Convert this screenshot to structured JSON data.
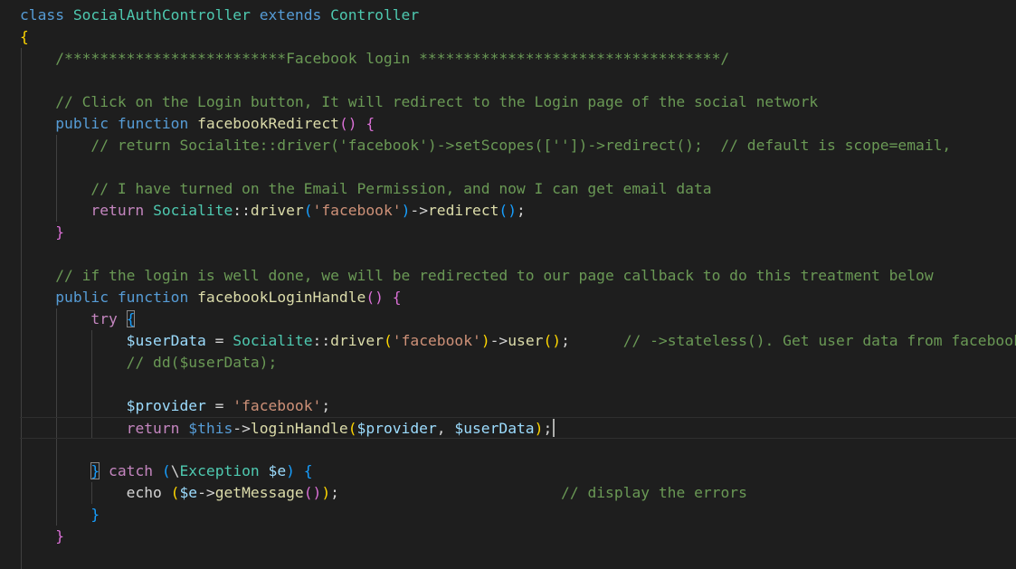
{
  "editor": {
    "language": "php",
    "theme": "dark",
    "current_line": 19,
    "colors": {
      "background": "#1e1e1e",
      "keyword": "#569cd6",
      "class": "#4ec9b0",
      "function": "#dcdcaa",
      "variable": "#9cdcfe",
      "string": "#ce9178",
      "comment": "#6a9955",
      "control": "#c586c0",
      "text": "#d4d4d4",
      "bracket1": "#ffd700",
      "bracket2": "#da70d6",
      "bracket3": "#179fff"
    },
    "lines": [
      [
        {
          "t": "class",
          "c": "kw"
        },
        {
          "t": " ",
          "c": "txt"
        },
        {
          "t": "SocialAuthController",
          "c": "cls"
        },
        {
          "t": " ",
          "c": "txt"
        },
        {
          "t": "extends",
          "c": "kw"
        },
        {
          "t": " ",
          "c": "txt"
        },
        {
          "t": "Controller",
          "c": "cls"
        }
      ],
      [
        {
          "t": "{",
          "c": "b1"
        }
      ],
      [
        {
          "t": "    ",
          "c": "txt"
        },
        {
          "t": "/*************************Facebook login **********************************/",
          "c": "com"
        }
      ],
      [],
      [
        {
          "t": "    ",
          "c": "txt"
        },
        {
          "t": "// Click on the Login button, It will redirect to the Login page of the social network",
          "c": "com"
        }
      ],
      [
        {
          "t": "    ",
          "c": "txt"
        },
        {
          "t": "public",
          "c": "kw"
        },
        {
          "t": " ",
          "c": "txt"
        },
        {
          "t": "function",
          "c": "kw"
        },
        {
          "t": " ",
          "c": "txt"
        },
        {
          "t": "facebookRedirect",
          "c": "fn"
        },
        {
          "t": "()",
          "c": "b2"
        },
        {
          "t": " ",
          "c": "txt"
        },
        {
          "t": "{",
          "c": "b2"
        }
      ],
      [
        {
          "t": "        ",
          "c": "txt"
        },
        {
          "t": "// return Socialite::driver('facebook')->setScopes([''])->redirect();  // default is scope=email,",
          "c": "com"
        }
      ],
      [],
      [
        {
          "t": "        ",
          "c": "txt"
        },
        {
          "t": "// I have turned on the Email Permission, and now I can get email data",
          "c": "com"
        }
      ],
      [
        {
          "t": "        ",
          "c": "txt"
        },
        {
          "t": "return",
          "c": "ctl"
        },
        {
          "t": " ",
          "c": "txt"
        },
        {
          "t": "Socialite",
          "c": "cls"
        },
        {
          "t": "::",
          "c": "txt"
        },
        {
          "t": "driver",
          "c": "fn"
        },
        {
          "t": "(",
          "c": "b3"
        },
        {
          "t": "'facebook'",
          "c": "str"
        },
        {
          "t": ")",
          "c": "b3"
        },
        {
          "t": "->",
          "c": "txt"
        },
        {
          "t": "redirect",
          "c": "fn"
        },
        {
          "t": "()",
          "c": "b3"
        },
        {
          "t": ";",
          "c": "txt"
        }
      ],
      [
        {
          "t": "    ",
          "c": "txt"
        },
        {
          "t": "}",
          "c": "b2"
        }
      ],
      [],
      [
        {
          "t": "    ",
          "c": "txt"
        },
        {
          "t": "// if the login is well done, we will be redirected to our page callback to do this treatment below",
          "c": "com"
        }
      ],
      [
        {
          "t": "    ",
          "c": "txt"
        },
        {
          "t": "public",
          "c": "kw"
        },
        {
          "t": " ",
          "c": "txt"
        },
        {
          "t": "function",
          "c": "kw"
        },
        {
          "t": " ",
          "c": "txt"
        },
        {
          "t": "facebookLoginHandle",
          "c": "fn"
        },
        {
          "t": "()",
          "c": "b2"
        },
        {
          "t": " ",
          "c": "txt"
        },
        {
          "t": "{",
          "c": "b2"
        }
      ],
      [
        {
          "t": "        ",
          "c": "txt"
        },
        {
          "t": "try",
          "c": "ctl"
        },
        {
          "t": " ",
          "c": "txt"
        },
        {
          "t": "{",
          "c": "b3",
          "boxed": true
        }
      ],
      [
        {
          "t": "            ",
          "c": "txt"
        },
        {
          "t": "$userData",
          "c": "var"
        },
        {
          "t": " = ",
          "c": "txt"
        },
        {
          "t": "Socialite",
          "c": "cls"
        },
        {
          "t": "::",
          "c": "txt"
        },
        {
          "t": "driver",
          "c": "fn"
        },
        {
          "t": "(",
          "c": "b1"
        },
        {
          "t": "'facebook'",
          "c": "str"
        },
        {
          "t": ")",
          "c": "b1"
        },
        {
          "t": "->",
          "c": "txt"
        },
        {
          "t": "user",
          "c": "fn"
        },
        {
          "t": "()",
          "c": "b1"
        },
        {
          "t": ";",
          "c": "txt"
        },
        {
          "t": "      ",
          "c": "txt"
        },
        {
          "t": "// ->stateless(). Get user data from facebook",
          "c": "com"
        }
      ],
      [
        {
          "t": "            ",
          "c": "txt"
        },
        {
          "t": "// dd($userData);",
          "c": "com"
        }
      ],
      [],
      [
        {
          "t": "            ",
          "c": "txt"
        },
        {
          "t": "$provider",
          "c": "var"
        },
        {
          "t": " = ",
          "c": "txt"
        },
        {
          "t": "'facebook'",
          "c": "str"
        },
        {
          "t": ";",
          "c": "txt"
        }
      ],
      [
        {
          "t": "            ",
          "c": "txt"
        },
        {
          "t": "return",
          "c": "ctl"
        },
        {
          "t": " ",
          "c": "txt"
        },
        {
          "t": "$this",
          "c": "kw"
        },
        {
          "t": "->",
          "c": "txt"
        },
        {
          "t": "loginHandle",
          "c": "fn"
        },
        {
          "t": "(",
          "c": "b1"
        },
        {
          "t": "$provider",
          "c": "var"
        },
        {
          "t": ", ",
          "c": "txt"
        },
        {
          "t": "$userData",
          "c": "var"
        },
        {
          "t": ")",
          "c": "b1"
        },
        {
          "t": ";",
          "c": "txt"
        }
      ],
      [],
      [
        {
          "t": "        ",
          "c": "txt"
        },
        {
          "t": "}",
          "c": "b3",
          "boxed": true
        },
        {
          "t": " ",
          "c": "txt"
        },
        {
          "t": "catch",
          "c": "ctl"
        },
        {
          "t": " ",
          "c": "txt"
        },
        {
          "t": "(",
          "c": "b3"
        },
        {
          "t": "\\",
          "c": "txt"
        },
        {
          "t": "Exception",
          "c": "cls"
        },
        {
          "t": " ",
          "c": "txt"
        },
        {
          "t": "$e",
          "c": "var"
        },
        {
          "t": ")",
          "c": "b3"
        },
        {
          "t": " ",
          "c": "txt"
        },
        {
          "t": "{",
          "c": "b3"
        }
      ],
      [
        {
          "t": "            ",
          "c": "txt"
        },
        {
          "t": "echo",
          "c": "txt"
        },
        {
          "t": " ",
          "c": "txt"
        },
        {
          "t": "(",
          "c": "b1"
        },
        {
          "t": "$e",
          "c": "var"
        },
        {
          "t": "->",
          "c": "txt"
        },
        {
          "t": "getMessage",
          "c": "fn"
        },
        {
          "t": "()",
          "c": "b2"
        },
        {
          "t": ")",
          "c": "b1"
        },
        {
          "t": ";",
          "c": "txt"
        },
        {
          "t": "                         ",
          "c": "txt"
        },
        {
          "t": "// display the errors",
          "c": "com"
        }
      ],
      [
        {
          "t": "        ",
          "c": "txt"
        },
        {
          "t": "}",
          "c": "b3"
        }
      ],
      [
        {
          "t": "    ",
          "c": "txt"
        },
        {
          "t": "}",
          "c": "b2"
        }
      ]
    ]
  }
}
